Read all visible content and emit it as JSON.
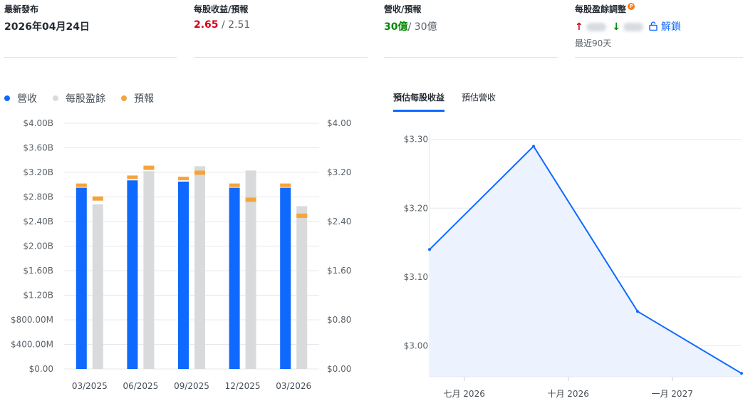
{
  "stats": {
    "latest_release": {
      "label": "最新發布",
      "value": "2026年04月24日"
    },
    "eps": {
      "label": "每股收益/預報",
      "actual": "2.65",
      "separator": " / ",
      "estimate": "2.51"
    },
    "revenue": {
      "label": "營收/預報",
      "actual": "30億",
      "separator": "/ ",
      "estimate": "30億"
    },
    "eps_revisions": {
      "label": "每股盈餘調整",
      "badge": "P",
      "up_arrow": "↑",
      "down_arrow": "↓",
      "unlock_label": "解鎖",
      "period": "最近90天"
    }
  },
  "legend": [
    {
      "label": "營收",
      "color": "#0f69ff"
    },
    {
      "label": "每股盈餘",
      "color": "#d8dadc"
    },
    {
      "label": "預報",
      "color": "#f4a43c"
    }
  ],
  "tabs": [
    {
      "label": "預估每股收益",
      "active": true
    },
    {
      "label": "預估營收",
      "active": false
    }
  ],
  "colors": {
    "revenue": "#0f69ff",
    "eps": "#d8dadc",
    "estimate": "#f4a43c",
    "line": "#0f69ff",
    "area": "#ecf3fe"
  },
  "chart_data": [
    {
      "type": "bar",
      "categories": [
        "03/2025",
        "06/2025",
        "09/2025",
        "12/2025",
        "03/2026"
      ],
      "series": [
        {
          "name": "營收",
          "axis": "left",
          "values": [
            2.95,
            3.07,
            3.05,
            2.95,
            2.95
          ]
        },
        {
          "name": "每股盈餘",
          "axis": "right",
          "values": [
            2.68,
            3.22,
            3.3,
            3.23,
            2.65
          ]
        },
        {
          "name": "預報",
          "axis": "both",
          "revenue_estimate": [
            2.99,
            3.12,
            3.1,
            2.99,
            2.99
          ],
          "eps_estimate": [
            2.78,
            3.28,
            3.2,
            2.76,
            2.5
          ]
        }
      ],
      "left_axis": {
        "ticks": [
          "$0.00",
          "$400.00M",
          "$800.00M",
          "$1.20B",
          "$1.60B",
          "$2.00B",
          "$2.40B",
          "$2.80B",
          "$3.20B",
          "$3.60B",
          "$4.00B"
        ],
        "ylim": [
          0,
          4.0
        ]
      },
      "right_axis": {
        "ticks": [
          "$0.00",
          "$0.80",
          "$1.60",
          "$2.40",
          "$3.20",
          "$4.00"
        ],
        "ylim": [
          0,
          4.0
        ]
      },
      "grid": true
    },
    {
      "type": "area",
      "x": [
        "2026-06",
        "2026-09",
        "2026-12",
        "2027-03"
      ],
      "y": [
        3.14,
        3.29,
        3.05,
        2.96
      ],
      "x_ticks": [
        "七月 2026",
        "十月 2026",
        "一月 2027"
      ],
      "y_ticks": [
        "$3.00",
        "$3.10",
        "$3.20",
        "$3.30"
      ],
      "ylim": [
        2.955,
        3.31
      ],
      "grid": true
    }
  ]
}
